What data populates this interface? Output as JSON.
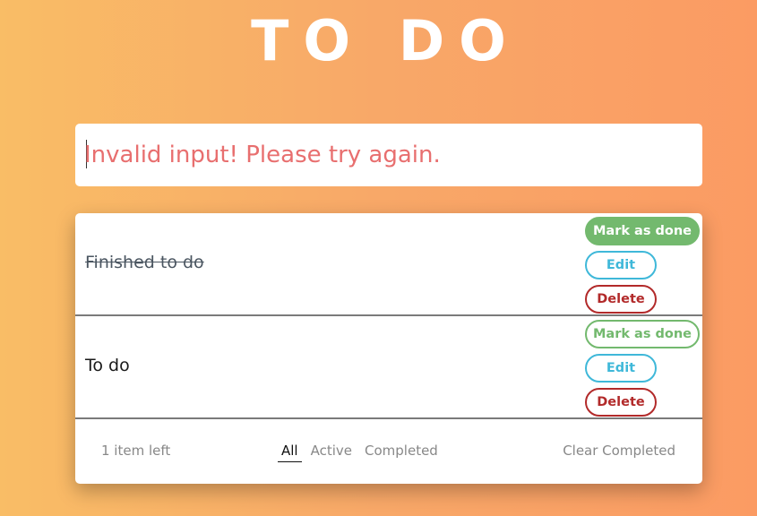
{
  "app": {
    "title": "TO DO"
  },
  "input": {
    "placeholder": "Invalid input! Please try again."
  },
  "todos": [
    {
      "text": "Finished to do",
      "completed": true,
      "mark_label": "Mark as done",
      "edit_label": "Edit",
      "delete_label": "Delete"
    },
    {
      "text": "To do",
      "completed": false,
      "mark_label": "Mark as done",
      "edit_label": "Edit",
      "delete_label": "Delete"
    }
  ],
  "footer": {
    "items_left": "1 item left",
    "filters": [
      "All",
      "Active",
      "Completed"
    ],
    "active_filter": "All",
    "clear_label": "Clear Completed"
  },
  "colors": {
    "done_green": "#73b96e",
    "edit_blue": "#3fb8d9",
    "delete_red": "#b22a2a",
    "error_text": "#e86f6f"
  }
}
